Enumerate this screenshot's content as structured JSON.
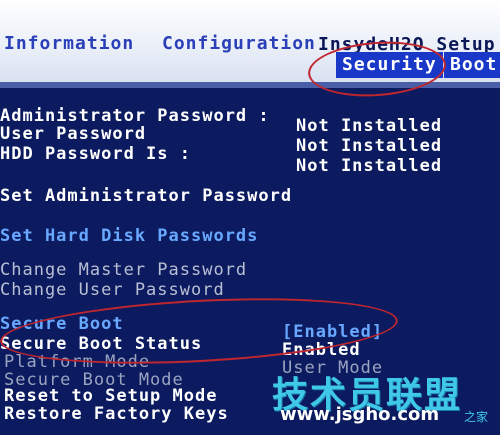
{
  "header": {
    "vendor": "InsydeH2O Setup",
    "tabs": [
      {
        "label": "Information"
      },
      {
        "label": "Configuration"
      },
      {
        "label": "Security"
      },
      {
        "label": "Boot"
      }
    ]
  },
  "passwords": {
    "administrator_label": "Administrator Password :",
    "administrator_value": "Not Installed",
    "user_label": "User Password",
    "user_value": "Not Installed",
    "hdd_label": "HDD Password Is :",
    "hdd_value": "Not Installed"
  },
  "actions": {
    "set_admin": "Set Administrator Password",
    "set_hdd": "Set Hard Disk Passwords",
    "change_master": "Change Master Password",
    "change_user": "Change User Password"
  },
  "secure_boot": {
    "secure_boot_label": "Secure Boot",
    "secure_boot_value": "[Enabled]",
    "status_label": "Secure Boot Status",
    "status_value": "Enabled",
    "platform_mode_label": "Platform Mode",
    "platform_mode_value": "User Mode",
    "secure_boot_mode_label": "Secure Boot Mode",
    "reset_label": "Reset to Setup Mode",
    "restore_label": "Restore Factory Keys"
  },
  "watermark": {
    "main": "技术员联盟",
    "url": "www.jsgho.com",
    "small": "之家"
  },
  "colors": {
    "background": "#0c1b5f",
    "tab_active": "#1a38c8",
    "link_blue": "#69a8ff",
    "annotation_red": "#c0262e",
    "watermark_cyan": "#3fc8e8"
  }
}
